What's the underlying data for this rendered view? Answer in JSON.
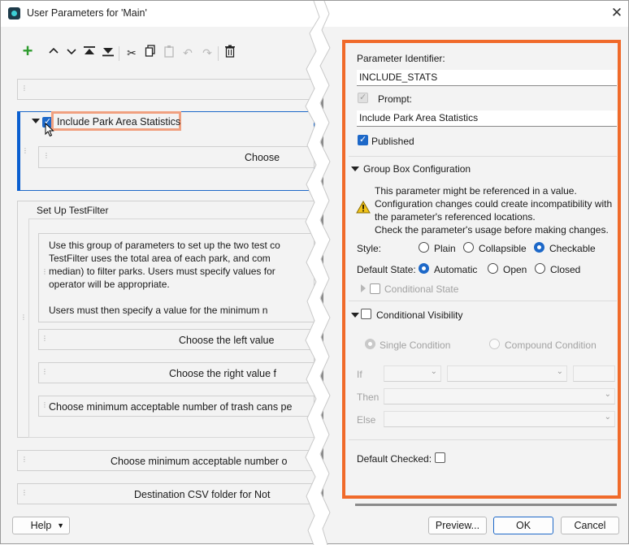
{
  "window": {
    "title": "User Parameters for 'Main'"
  },
  "toolbar": {
    "items": [
      "add",
      "move-up",
      "move-down",
      "move-top",
      "move-bottom",
      "cut",
      "copy",
      "paste",
      "undo",
      "redo",
      "delete"
    ]
  },
  "tree": {
    "group1": {
      "label": "Include Park Area Statistics",
      "child": "Choose"
    },
    "group2": {
      "label": "Set Up TestFilter",
      "description": [
        "Use this group of parameters to set up the two test co",
        "TestFilter uses the total area of each park, and com",
        "median) to filter parks. Users must specify values for",
        "operator will be appropriate.",
        "Users must then specify a value for the minimum n"
      ],
      "children": [
        "Choose the left value",
        "Choose the right value f",
        "Choose minimum acceptable number of trash cans pe"
      ]
    },
    "row_trash": "Choose minimum acceptable number o",
    "row_dest": "Destination CSV folder for Not"
  },
  "props": {
    "identifier_label": "Parameter Identifier:",
    "identifier_value": "INCLUDE_STATS",
    "prompt_label": "Prompt:",
    "prompt_value": "Include Park Area Statistics",
    "published_label": "Published",
    "group_box_title": "Group Box Configuration",
    "warning": [
      "This parameter might be referenced in a value.",
      "Configuration changes could create incompatibility with",
      "the parameter's referenced locations.",
      "Check the parameter's usage before making changes."
    ],
    "style_label": "Style:",
    "style_options": [
      "Plain",
      "Collapsible",
      "Checkable"
    ],
    "style_selected": "Checkable",
    "default_state_label": "Default State:",
    "state_options": [
      "Automatic",
      "Open",
      "Closed"
    ],
    "state_selected": "Automatic",
    "conditional_state": "Conditional State",
    "cond_vis_title": "Conditional Visibility",
    "condition_options": [
      "Single Condition",
      "Compound Condition"
    ],
    "if_label": "If",
    "then_label": "Then",
    "else_label": "Else",
    "default_checked_label": "Default Checked:"
  },
  "footer": {
    "help": "Help",
    "preview": "Preview...",
    "ok": "OK",
    "cancel": "Cancel"
  },
  "colors": {
    "accent": "#1d68c8",
    "highlight_box": "#f06a2a",
    "tree_label_box": "#f0a080"
  }
}
